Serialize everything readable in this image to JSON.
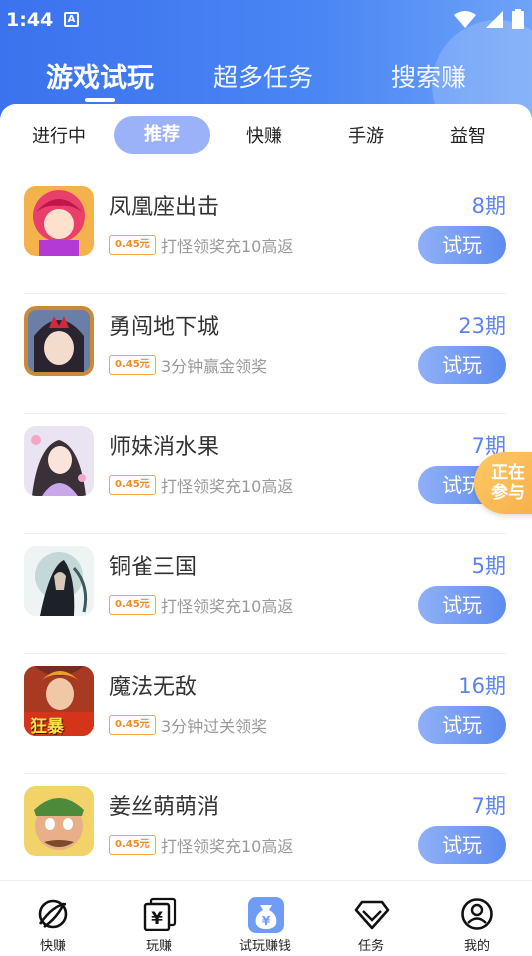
{
  "status_bar": {
    "time": "1:44",
    "notif_glyph": "A"
  },
  "top_tabs": [
    {
      "label": "游戏试玩",
      "active": true
    },
    {
      "label": "超多任务",
      "active": false
    },
    {
      "label": "搜索赚",
      "active": false
    }
  ],
  "category_tabs": [
    {
      "label": "进行中",
      "active": false
    },
    {
      "label": "推荐",
      "active": true
    },
    {
      "label": "快赚",
      "active": false
    },
    {
      "label": "手游",
      "active": false
    },
    {
      "label": "益智",
      "active": false
    }
  ],
  "games": [
    {
      "name": "凤凰座出击",
      "reward": "0.45元",
      "desc": "打怪领奖充10高返",
      "period": "8期",
      "button": "试玩"
    },
    {
      "name": "勇闯地下城",
      "reward": "0.45元",
      "desc": "3分钟赢金领奖",
      "period": "23期",
      "button": "试玩"
    },
    {
      "name": "师妹消水果",
      "reward": "0.45元",
      "desc": "打怪领奖充10高返",
      "period": "7期",
      "button": "试玩"
    },
    {
      "name": "铜雀三国",
      "reward": "0.45元",
      "desc": "打怪领奖充10高返",
      "period": "5期",
      "button": "试玩"
    },
    {
      "name": "魔法无敌",
      "reward": "0.45元",
      "desc": "3分钟过关领奖",
      "period": "16期",
      "button": "试玩",
      "icon_text": "狂暴"
    },
    {
      "name": "姜丝萌萌消",
      "reward": "0.45元",
      "desc": "打怪领奖充10高返",
      "period": "7期",
      "button": "试玩"
    }
  ],
  "floating_badge": {
    "line1": "正在",
    "line2": "参与"
  },
  "bottom_nav": [
    {
      "label": "快赚",
      "icon": "planet-icon"
    },
    {
      "label": "玩赚",
      "icon": "yuan-cards-icon"
    },
    {
      "label": "试玩赚钱",
      "icon": "money-bag-icon",
      "active": true
    },
    {
      "label": "任务",
      "icon": "diamond-icon"
    },
    {
      "label": "我的",
      "icon": "user-icon"
    }
  ],
  "colors": {
    "header_blue": "#3b72ee",
    "accent_blue": "#5b83ee",
    "reward_orange": "#f08a2a",
    "badge_yellow": "#f6b04a"
  }
}
